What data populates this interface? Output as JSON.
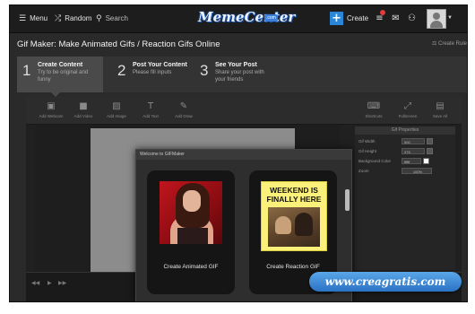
{
  "topbar": {
    "menu_label": "Menu",
    "random_label": "Random",
    "search_placeholder": "Search",
    "logo_text": "MemeCenter",
    "logo_tld": ".com",
    "create_label": "Create",
    "icons": [
      "menu-icon",
      "shuffle-icon",
      "search-icon",
      "plus-icon",
      "list-icon",
      "mail-icon",
      "group-icon",
      "avatar"
    ]
  },
  "header": {
    "title": "Gif Maker: Make Animated Gifs / Reaction Gifs Online",
    "create_rule": "Create Rule"
  },
  "steps": [
    {
      "num": "1",
      "title": "Create Content",
      "subtitle": "Try to be original and funny"
    },
    {
      "num": "2",
      "title": "Post Your Content",
      "subtitle": "Please fill inputs"
    },
    {
      "num": "3",
      "title": "See Your Post",
      "subtitle": "Share your post with your friends"
    }
  ],
  "toolbar": {
    "tools": [
      {
        "icon": "▣",
        "label": "Add Webcam"
      },
      {
        "icon": "■",
        "label": "Add Video"
      },
      {
        "icon": "▨",
        "label": "Add Image"
      },
      {
        "icon": "T",
        "label": "Add Text"
      },
      {
        "icon": "✎",
        "label": "Add Draw"
      }
    ],
    "right_tools": [
      {
        "icon": "⌨",
        "label": "Shortcuts"
      },
      {
        "icon": "⤢",
        "label": "Fullscreen"
      },
      {
        "icon": "▤",
        "label": "Save All"
      }
    ]
  },
  "properties": {
    "heading": "Gif Properties",
    "rows": [
      {
        "label": "Gif Width",
        "value": "500"
      },
      {
        "label": "Gif Height",
        "value": "375"
      },
      {
        "label": "Background Color",
        "value": "ffffff"
      },
      {
        "label": "Zoom",
        "value": "100%"
      }
    ]
  },
  "modal": {
    "title": "Welcome to GIFMaker",
    "card1_label": "Create Animated GIF",
    "card2_label": "Create Reaction GIF",
    "card2_image_text": "WEEKEND IS FINALLY HERE"
  },
  "watermark": {
    "text": "www.creagratis.com"
  },
  "colors": {
    "accent": "#2a86d6",
    "background": "#2a2a2a",
    "topbar": "#1d1d1d",
    "reaction_bg": "#fbf07a"
  }
}
